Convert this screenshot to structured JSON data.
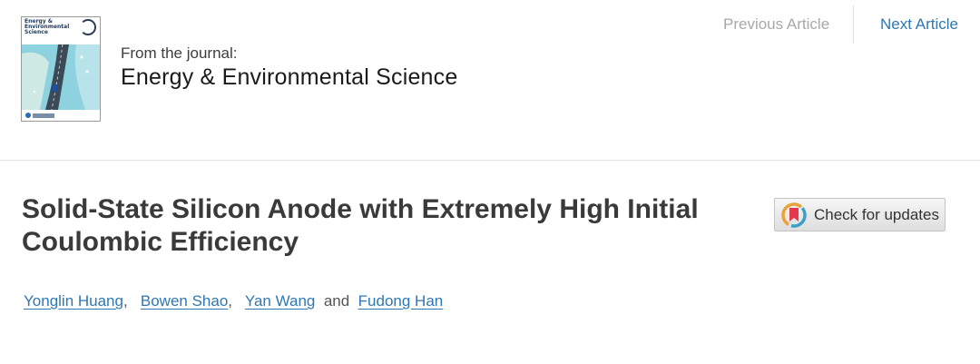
{
  "header": {
    "cover": {
      "title_lines": [
        "Energy &",
        "Environmental",
        "Science"
      ],
      "alt": "Journal cover"
    },
    "from_label": "From the journal:",
    "journal_name": "Energy & Environmental Science",
    "nav": {
      "previous_label": "Previous Article",
      "next_label": "Next Article",
      "previous_color": "#a8a8a8",
      "next_color": "#2f77b2"
    }
  },
  "article": {
    "title": "Solid-State Silicon Anode with Extremely High Initial Coulombic Efficiency",
    "check_updates_label": "Check for updates",
    "authors": [
      "Yonglin Huang",
      "Bowen Shao",
      "Yan Wang",
      "Fudong Han"
    ],
    "author_separator": ",",
    "author_conjunction": "and"
  },
  "colors": {
    "link": "#2f77b2",
    "title": "#3a3a3a"
  },
  "icons": {
    "check_updates": "crossmark-icon"
  }
}
